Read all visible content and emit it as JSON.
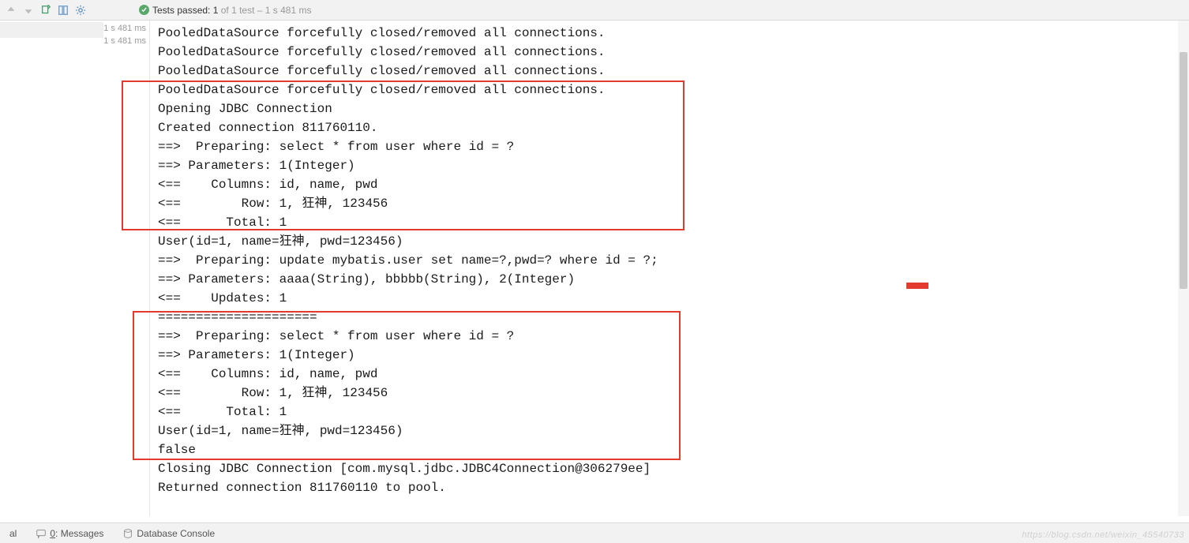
{
  "toolbar": {
    "icons": [
      "arrow-up",
      "arrow-down",
      "export",
      "layout",
      "gear"
    ]
  },
  "status": {
    "prefix": "Tests passed: ",
    "count": "1",
    "rest": " of 1 test – 1 s 481 ms"
  },
  "gutter": {
    "time1": "1 s 481 ms",
    "time2": "1 s 481 ms"
  },
  "console_lines": [
    "PooledDataSource forcefully closed/removed all connections.",
    "PooledDataSource forcefully closed/removed all connections.",
    "PooledDataSource forcefully closed/removed all connections.",
    "PooledDataSource forcefully closed/removed all connections.",
    "Opening JDBC Connection",
    "Created connection 811760110.",
    "==>  Preparing: select * from user where id = ?",
    "==> Parameters: 1(Integer)",
    "<==    Columns: id, name, pwd",
    "<==        Row: 1, 狂神, 123456",
    "<==      Total: 1",
    "User(id=1, name=狂神, pwd=123456)",
    "==>  Preparing: update mybatis.user set name=?,pwd=? where id = ?;",
    "==> Parameters: aaaa(String), bbbbb(String), 2(Integer)",
    "<==    Updates: 1",
    "=====================",
    "==>  Preparing: select * from user where id = ?",
    "==> Parameters: 1(Integer)",
    "<==    Columns: id, name, pwd",
    "<==        Row: 1, 狂神, 123456",
    "<==      Total: 1",
    "User(id=1, name=狂神, pwd=123456)",
    "false",
    "Closing JDBC Connection [com.mysql.jdbc.JDBC4Connection@306279ee]",
    "Returned connection 811760110 to pool."
  ],
  "bottom": {
    "terminal": "al",
    "messages_key": "0",
    "messages_rest": ": Messages",
    "database": "Database Console"
  },
  "watermark": "https://blog.csdn.net/weixin_45540733"
}
